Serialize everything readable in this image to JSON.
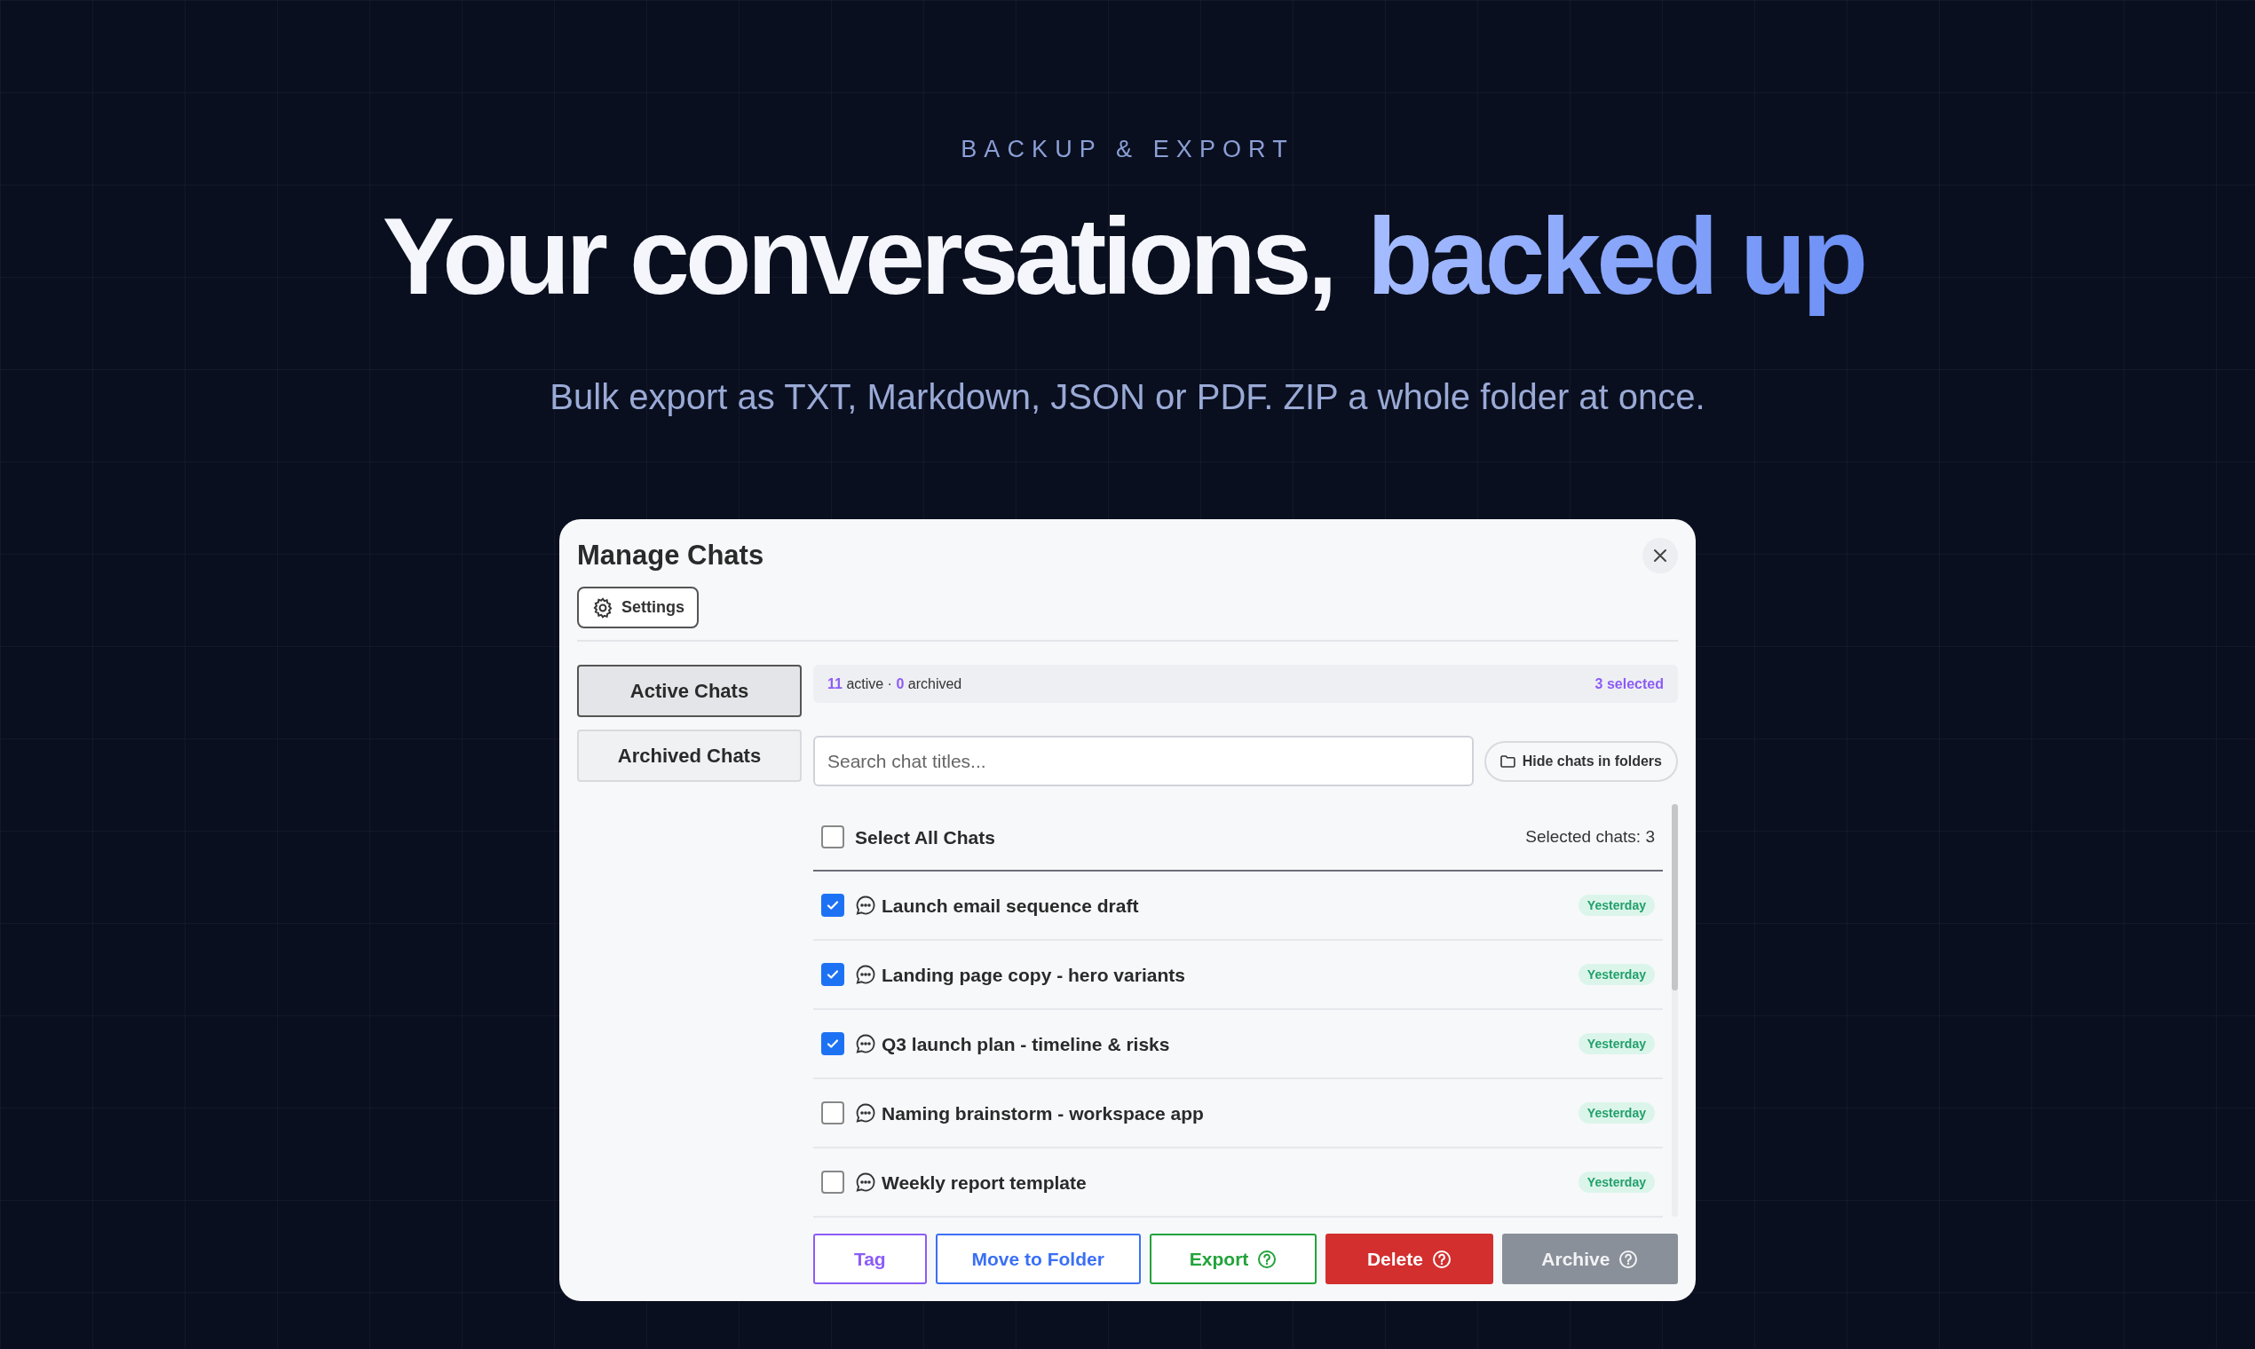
{
  "hero": {
    "eyebrow": "BACKUP & EXPORT",
    "title_lead": "Your conversations,",
    "title_highlight": "backed up",
    "subtitle": "Bulk export as TXT, Markdown, JSON or PDF. ZIP a whole folder at once."
  },
  "dialog": {
    "title": "Manage Chats",
    "settings_button": "Settings",
    "tabs": [
      {
        "label": "Active Chats",
        "selected": true
      },
      {
        "label": "Archived Chats",
        "selected": false
      }
    ],
    "stats": {
      "active_count": "11",
      "active_label": "active ·",
      "archived_count": "0",
      "archived_label": "archived",
      "selected": "3 selected"
    },
    "search": {
      "placeholder": "Search chat titles..."
    },
    "hide_folders_button": "Hide chats in folders",
    "select_all": {
      "label": "Select All Chats",
      "checked": false,
      "count": "Selected chats: 3"
    },
    "chats": [
      {
        "title": "Launch email sequence draft",
        "date": "Yesterday",
        "checked": true
      },
      {
        "title": "Landing page copy - hero variants",
        "date": "Yesterday",
        "checked": true
      },
      {
        "title": "Q3 launch plan - timeline & risks",
        "date": "Yesterday",
        "checked": true
      },
      {
        "title": "Naming brainstorm - workspace app",
        "date": "Yesterday",
        "checked": false
      },
      {
        "title": "Weekly report template",
        "date": "Yesterday",
        "checked": false
      }
    ],
    "actions": [
      {
        "label": "Tag",
        "kind": "tag",
        "help": false
      },
      {
        "label": "Move to Folder",
        "kind": "folder",
        "help": false
      },
      {
        "label": "Export",
        "kind": "export",
        "help": true
      },
      {
        "label": "Delete",
        "kind": "delete",
        "help": true
      },
      {
        "label": "Archive",
        "kind": "archive",
        "help": true
      }
    ]
  }
}
